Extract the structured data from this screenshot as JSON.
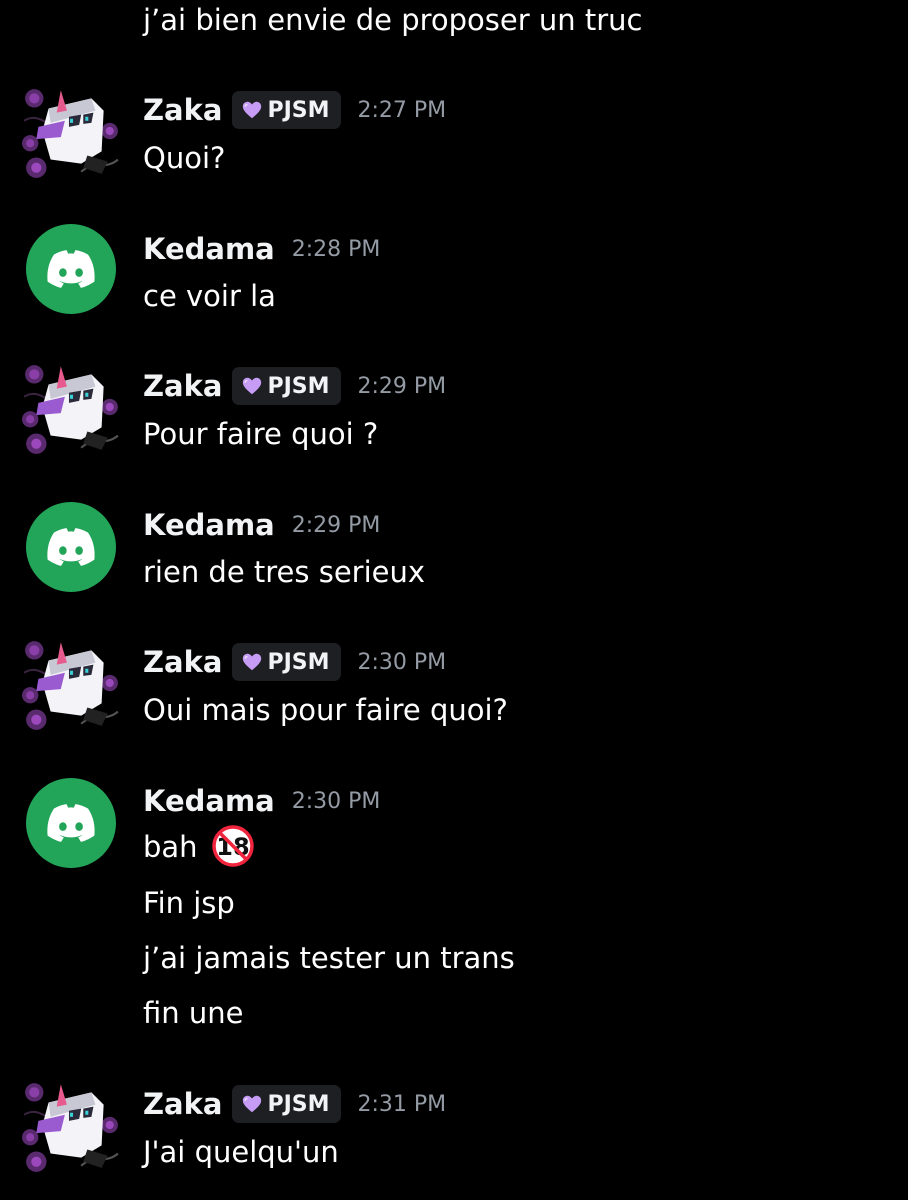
{
  "messages": [
    {
      "author": "",
      "lines": [
        "j’ai bien envie de proposer un truc"
      ]
    },
    {
      "author": "Zaka",
      "tag": "PJSM",
      "time": "2:27 PM",
      "lines": [
        "Quoi?"
      ]
    },
    {
      "author": "Kedama",
      "time": "2:28 PM",
      "lines": [
        "ce voir la"
      ]
    },
    {
      "author": "Zaka",
      "tag": "PJSM",
      "time": "2:29 PM",
      "lines": [
        "Pour faire quoi ?"
      ]
    },
    {
      "author": "Kedama",
      "time": "2:29 PM",
      "lines": [
        "rien de tres serieux"
      ]
    },
    {
      "author": "Zaka",
      "tag": "PJSM",
      "time": "2:30 PM",
      "lines": [
        "Oui mais pour faire quoi?"
      ]
    },
    {
      "author": "Kedama",
      "time": "2:30 PM",
      "lines": [
        "bah",
        "Fin jsp",
        "j’ai jamais tester un trans",
        "fin une"
      ],
      "emoji": "no-one-under-eighteen-emoji"
    },
    {
      "author": "Zaka",
      "tag": "PJSM",
      "time": "2:31 PM",
      "lines": [
        "J'ai quelqu'un"
      ]
    }
  ],
  "colors": {
    "background": "#000000",
    "kedama_avatar": "#23a559",
    "role_heart": "#c69cf5",
    "timestamp": "#949ba4"
  },
  "icons": {
    "kedama_avatar": "discord-logo-icon",
    "zaka_avatar": "zaka-anime-avatar-icon",
    "role": "purple-heart-icon"
  }
}
